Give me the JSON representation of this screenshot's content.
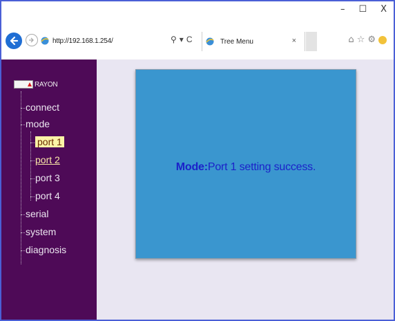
{
  "window": {
    "minimize_label": "–",
    "maximize_label": "☐",
    "close_label": "X"
  },
  "browser": {
    "url": "http://192.168.1.254/",
    "search_glyph": "⚲",
    "dropdown_glyph": "▾",
    "refresh_glyph": "C",
    "tab": {
      "title": "Tree Menu",
      "close": "×"
    },
    "tools": {
      "home_icon": "home-icon",
      "favorites_icon": "star-icon",
      "settings_icon": "gear-icon",
      "smiley_icon": "smiley-icon"
    }
  },
  "sidebar": {
    "root_label": "RAYON",
    "items": [
      {
        "label": "connect"
      },
      {
        "label": "mode"
      },
      {
        "label": "port 1"
      },
      {
        "label": "port 2"
      },
      {
        "label": "port 3"
      },
      {
        "label": "port 4"
      },
      {
        "label": "serial"
      },
      {
        "label": "system"
      },
      {
        "label": "diagnosis"
      }
    ]
  },
  "message": {
    "prefix": "Mode:",
    "text": "Port 1 setting success."
  },
  "colors": {
    "sidebar_bg": "#4e0a57",
    "panel_bg": "#3a96cf",
    "message_text": "#1b22c9",
    "selected_bg": "#fbf3a6"
  }
}
